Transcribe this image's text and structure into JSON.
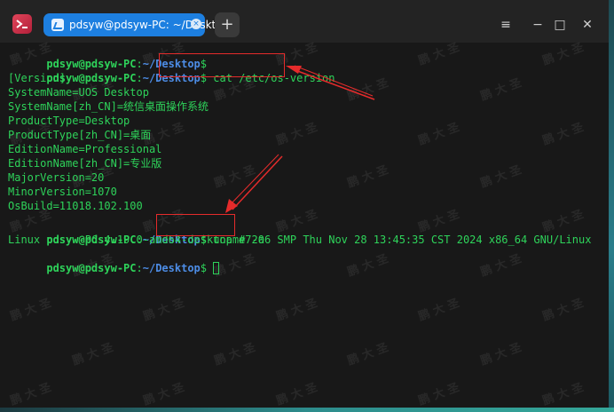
{
  "window": {
    "tab_title": "pdsyw@pdsyw-PC: ~/Desktop",
    "tab_close_glyph": "×",
    "add_tab_glyph": "+",
    "menu_glyph": "≡",
    "minimize_glyph": "−",
    "maximize_glyph": "□",
    "close_glyph": "✕"
  },
  "terminal": {
    "prompt": {
      "user_host": "pdsyw@pdsyw-PC",
      "sep": ":",
      "path": "~/Desktop",
      "dollar": "$"
    },
    "commands": {
      "cmd1": " cat /etc/os-version",
      "cmd2": " uname -a"
    },
    "output": [
      "[Version]",
      "SystemName=UOS Desktop",
      "SystemName[zh_CN]=统信桌面操作系统",
      "ProductType=Desktop",
      "ProductType[zh_CN]=桌面",
      "EditionName=Professional",
      "EditionName[zh_CN]=专业版",
      "MajorVersion=20",
      "MinorVersion=1070",
      "OsBuild=11018.102.100"
    ],
    "uname_output": "Linux pdsyw-PC 4.19.0-amd64-desktop #7206 SMP Thu Nov 28 13:45:35 CST 2024 x86_64 GNU/Linux"
  },
  "colors": {
    "accent": "#1d7fe0",
    "prompt_green": "#2ed35a",
    "path_blue": "#4d8de6",
    "annotation_red": "#e52b2b"
  },
  "watermark_text": "鹏 大 圣"
}
